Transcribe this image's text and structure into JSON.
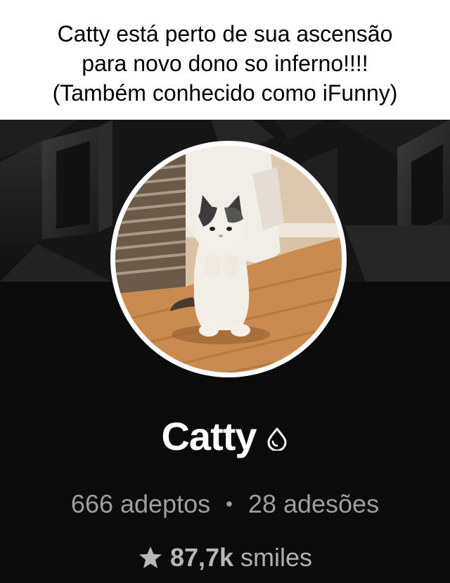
{
  "caption": {
    "line1": "Catty está perto de sua ascensão",
    "line2": "para novo dono so inferno!!!!",
    "line3": "(Também conhecido como iFunny)"
  },
  "profile": {
    "name": "Catty",
    "followers": "666 adeptos",
    "separator": "•",
    "subscriptions": "28 adesões",
    "smiles_count": "87,7k",
    "smiles_label": "smiles",
    "verified_icon": "drop-icon",
    "smiles_icon": "star-icon",
    "avatar_image": "cat-standing-photo"
  },
  "colors": {
    "background": "#0b0b0b",
    "name": "#ffffff",
    "stats": "#9e9e9e",
    "caption_bg": "#ffffff"
  }
}
